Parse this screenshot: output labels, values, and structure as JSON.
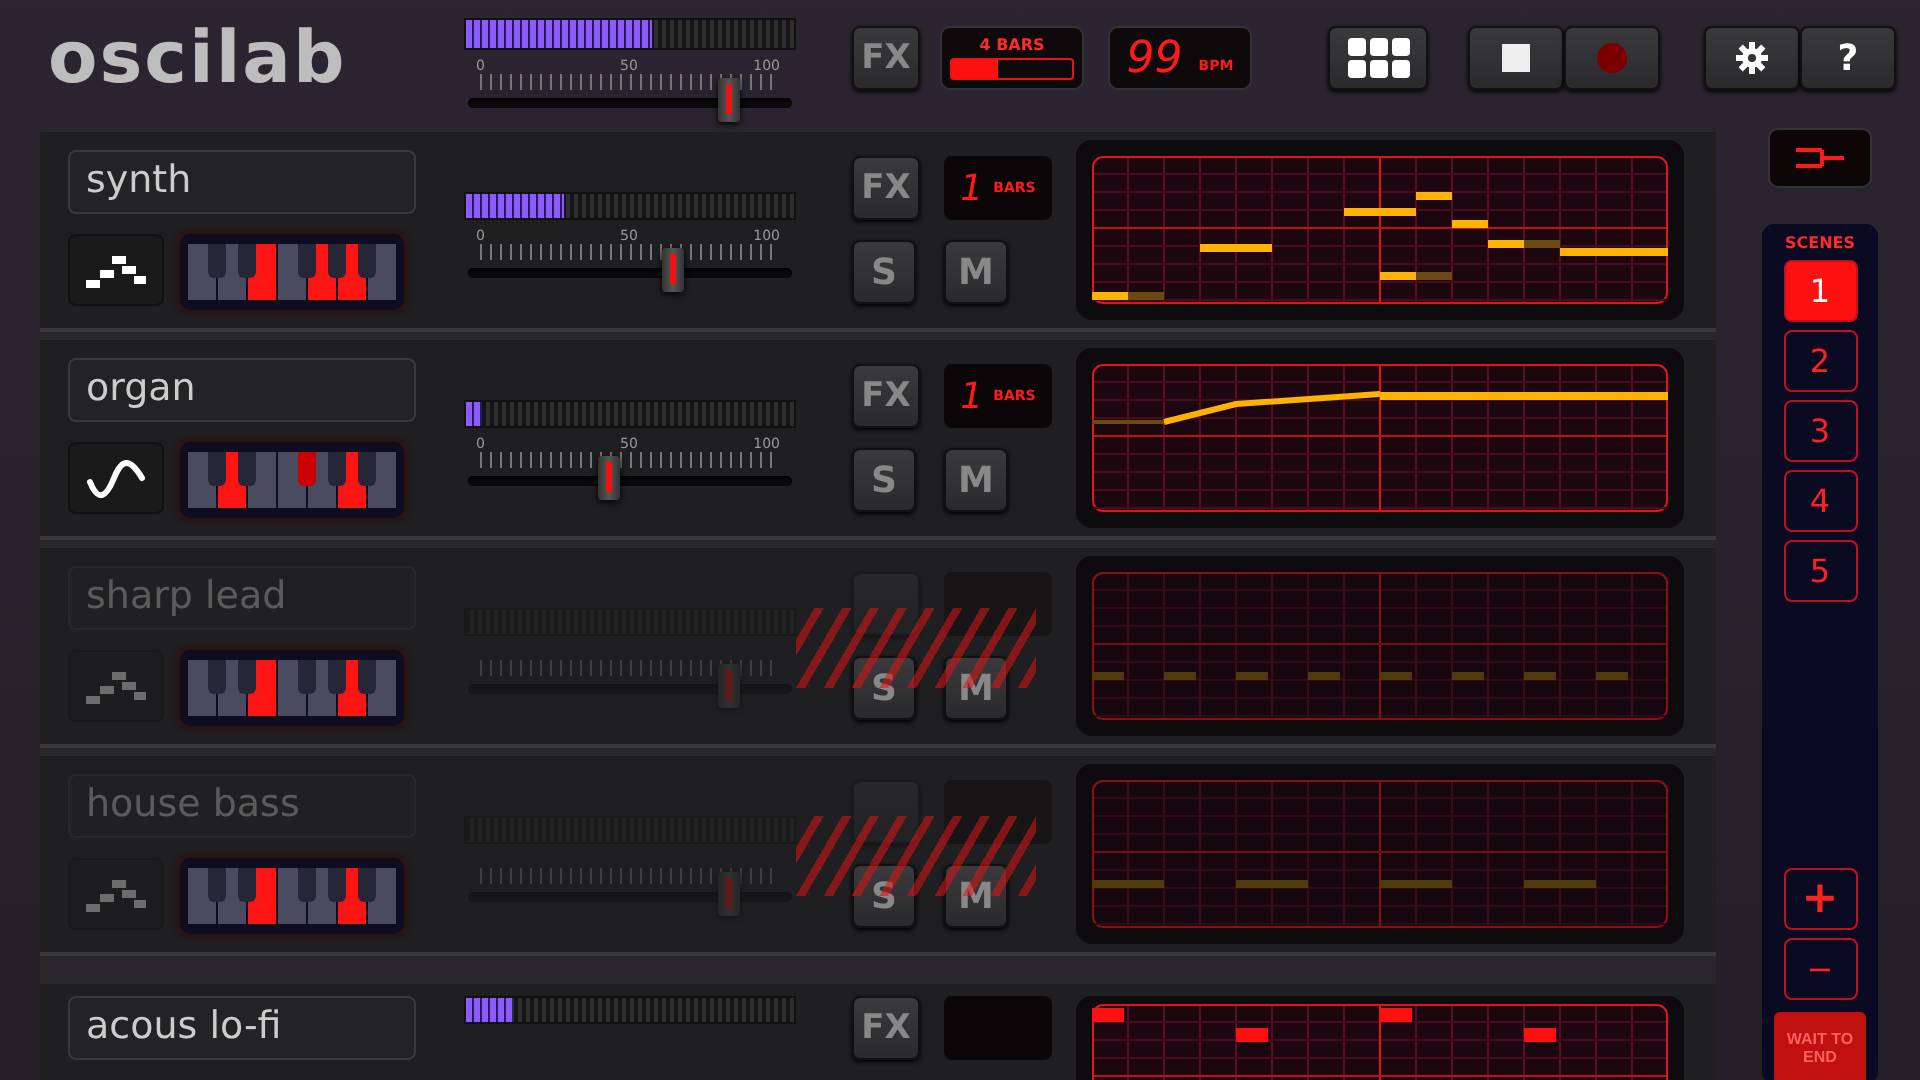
{
  "header": {
    "logo": "oscilab",
    "master_meter": {
      "level": 0.57
    },
    "master_volume": {
      "level": 0.8,
      "scale": [
        "0",
        "50",
        "100"
      ]
    },
    "fx_button": "FX",
    "loop_length": {
      "value": "4 BARS",
      "level": 0.38
    },
    "tempo": {
      "value": "99",
      "unit": "BPM"
    },
    "help_button": "?"
  },
  "tracks": [
    {
      "name": "synth",
      "sound_button": {
        "kind": "arpeggio"
      },
      "white_keys": [
        false,
        false,
        true,
        false,
        true,
        true,
        false
      ],
      "black_keys": [
        false,
        false,
        false,
        false,
        false
      ],
      "meter": {
        "level": 0.3
      },
      "volume": {
        "level": 0.63,
        "scale": [
          "0",
          "50",
          "100"
        ]
      },
      "fx": "FX",
      "bars": "1",
      "bars_unit": "BARS",
      "solo": "S",
      "mute": "M",
      "pattern": {
        "kind": "melody"
      },
      "enabled": true
    },
    {
      "name": "organ",
      "sound_button": {
        "kind": "sine"
      },
      "white_keys": [
        false,
        true,
        false,
        false,
        false,
        true,
        false
      ],
      "black_keys": [
        false,
        false,
        true,
        false,
        false
      ],
      "meter": {
        "level": 0.05
      },
      "volume": {
        "level": 0.43,
        "scale": [
          "0",
          "50",
          "100"
        ]
      },
      "fx": "FX",
      "bars": "1",
      "bars_unit": "BARS",
      "solo": "S",
      "mute": "M",
      "pattern": {
        "kind": "glide"
      },
      "enabled": true
    },
    {
      "name": "sharp lead",
      "sound_button": {
        "kind": "arpeggio"
      },
      "white_keys": [
        false,
        false,
        true,
        false,
        false,
        true,
        false
      ],
      "black_keys": [
        false,
        false,
        false,
        false,
        false
      ],
      "volume": {
        "level": 0.8
      },
      "solo": "S",
      "mute": "M",
      "pattern": {
        "kind": "pulse"
      },
      "enabled": false
    },
    {
      "name": "house bass",
      "sound_button": {
        "kind": "arpeggio"
      },
      "white_keys": [
        false,
        false,
        true,
        false,
        false,
        true,
        false
      ],
      "black_keys": [
        false,
        false,
        false,
        false,
        false
      ],
      "volume": {
        "level": 0.8
      },
      "solo": "S",
      "mute": "M",
      "pattern": {
        "kind": "bass"
      },
      "enabled": false
    },
    {
      "name": "acous lo-fi",
      "meter": {
        "level": 0.14
      },
      "fx": "FX",
      "pattern": {
        "kind": "drums"
      },
      "enabled": true
    }
  ],
  "scenes": {
    "title": "SCENES",
    "items": [
      {
        "label": "1",
        "selected": true
      },
      {
        "label": "2",
        "selected": false
      },
      {
        "label": "3",
        "selected": false
      },
      {
        "label": "4",
        "selected": false
      },
      {
        "label": "5",
        "selected": false
      }
    ],
    "add": "+",
    "remove": "−",
    "wait_button": "WAIT TO END"
  }
}
